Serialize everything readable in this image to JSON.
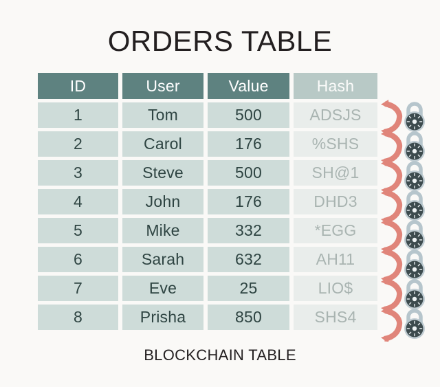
{
  "page": {
    "title": "ORDERS TABLE",
    "footer": "BLOCKCHAIN TABLE",
    "background_color": "#faf9f7"
  },
  "colors": {
    "header_teal": "#5e8280",
    "header_hash": "#b8c9c6",
    "cell_teal": "#cedcd9",
    "cell_hash": "#e9edeb",
    "cell_text": "#2e4442",
    "hash_text": "#a9b4b1",
    "arrow_coral": "#e0857a",
    "lock_body": "#3d4b4e",
    "lock_shackle": "#b6c5cc",
    "title_text": "#231f20"
  },
  "table": {
    "columns": [
      {
        "key": "id",
        "label": "ID"
      },
      {
        "key": "user",
        "label": "User"
      },
      {
        "key": "value",
        "label": "Value"
      },
      {
        "key": "hash",
        "label": "Hash"
      }
    ],
    "rows": [
      {
        "id": "1",
        "user": "Tom",
        "value": "500",
        "hash": "ADSJS"
      },
      {
        "id": "2",
        "user": "Carol",
        "value": "176",
        "hash": "%SHS"
      },
      {
        "id": "3",
        "user": "Steve",
        "value": "500",
        "hash": "SH@1"
      },
      {
        "id": "4",
        "user": "John",
        "value": "176",
        "hash": "DHD3"
      },
      {
        "id": "5",
        "user": "Mike",
        "value": "332",
        "hash": "*EGG"
      },
      {
        "id": "6",
        "user": "Sarah",
        "value": "632",
        "hash": "AH11"
      },
      {
        "id": "7",
        "user": "Eve",
        "value": "25",
        "hash": "LIO$"
      },
      {
        "id": "8",
        "user": "Prisha",
        "value": "850",
        "hash": "SHS4"
      }
    ]
  },
  "chain": {
    "count": 8,
    "arrow_icon": "curved-arrow-icon",
    "lock_icon": "combination-padlock-icon"
  }
}
